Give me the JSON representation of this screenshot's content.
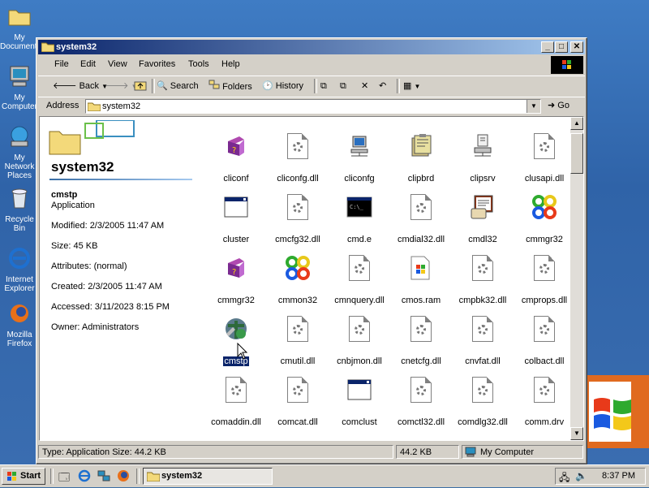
{
  "desktop": {
    "icons": [
      {
        "label": "My Documents"
      },
      {
        "label": "My Computer"
      },
      {
        "label": "My Network Places"
      },
      {
        "label": "Recycle Bin"
      },
      {
        "label": "Internet Explorer"
      },
      {
        "label": "Mozilla Firefox"
      }
    ]
  },
  "window": {
    "title": "system32",
    "controls": {
      "minimize": "_",
      "maximize": "□",
      "close": "✕"
    },
    "menu": [
      "File",
      "Edit",
      "View",
      "Favorites",
      "Tools",
      "Help"
    ],
    "toolbar": {
      "back": "Back",
      "search": "Search",
      "folders": "Folders",
      "history": "History"
    },
    "address": {
      "label": "Address",
      "value": "system32",
      "go": "Go"
    }
  },
  "left_pane": {
    "folder_title": "system32",
    "selected_name": "cmstp",
    "selected_type": "Application",
    "modified": "Modified: 2/3/2005 11:47 AM",
    "size": "Size: 45 KB",
    "attributes": "Attributes: (normal)",
    "created": "Created: 2/3/2005 11:47 AM",
    "accessed": "Accessed: 3/11/2023 8:15 PM",
    "owner": "Owner: Administrators"
  },
  "files": [
    {
      "label": "cliconf",
      "icon": "help-book-icon"
    },
    {
      "label": "cliconfg.dll",
      "icon": "dll-file-icon"
    },
    {
      "label": "cliconfg",
      "icon": "network-computer-icon"
    },
    {
      "label": "clipbrd",
      "icon": "clipboard-book-icon"
    },
    {
      "label": "clipsrv",
      "icon": "clipboard-server-icon"
    },
    {
      "label": "clusapi.dll",
      "icon": "dll-file-icon"
    },
    {
      "label": "cluster",
      "icon": "window-app-icon"
    },
    {
      "label": "cmcfg32.dll",
      "icon": "dll-file-icon"
    },
    {
      "label": "cmd.e",
      "icon": "command-prompt-icon"
    },
    {
      "label": "cmdial32.dll",
      "icon": "dll-file-icon"
    },
    {
      "label": "cmdl32",
      "icon": "phonebook-icon"
    },
    {
      "label": "cmmgr32",
      "icon": "connection-manager-icon"
    },
    {
      "label": "cmmgr32",
      "icon": "help-book-icon"
    },
    {
      "label": "cmmon32",
      "icon": "connection-manager-icon"
    },
    {
      "label": "cmnquery.dll",
      "icon": "dll-file-icon"
    },
    {
      "label": "cmos.ram",
      "icon": "windows-file-icon"
    },
    {
      "label": "cmpbk32.dll",
      "icon": "dll-file-icon"
    },
    {
      "label": "cmprops.dll",
      "icon": "dll-file-icon"
    },
    {
      "label": "cmstp",
      "icon": "cmstp-app-icon",
      "selected": true
    },
    {
      "label": "cmutil.dll",
      "icon": "dll-file-icon"
    },
    {
      "label": "cnbjmon.dll",
      "icon": "dll-file-icon"
    },
    {
      "label": "cnetcfg.dll",
      "icon": "dll-file-icon"
    },
    {
      "label": "cnvfat.dll",
      "icon": "dll-file-icon"
    },
    {
      "label": "colbact.dll",
      "icon": "dll-file-icon"
    },
    {
      "label": "comaddin.dll",
      "icon": "dll-file-icon"
    },
    {
      "label": "comcat.dll",
      "icon": "dll-file-icon"
    },
    {
      "label": "comclust",
      "icon": "window-app-icon"
    },
    {
      "label": "comctl32.dll",
      "icon": "dll-file-icon"
    },
    {
      "label": "comdlg32.dll",
      "icon": "dll-file-icon"
    },
    {
      "label": "comm.drv",
      "icon": "dll-file-icon"
    }
  ],
  "statusbar": {
    "info": "Type: Application Size: 44.2 KB",
    "size": "44.2 KB",
    "zone": "My Computer"
  },
  "taskbar": {
    "start": "Start",
    "task": "system32",
    "clock": "8:37 PM"
  },
  "colors": {
    "title_start": "#0a246a",
    "title_end": "#a6caf0",
    "selection": "#0a246a",
    "desktop": "#3a6ea5"
  }
}
